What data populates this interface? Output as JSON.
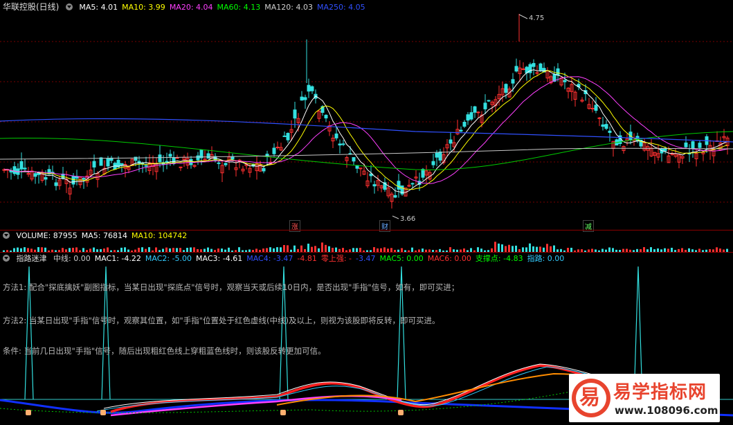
{
  "kline": {
    "title": "华联控股(日线)",
    "ma": [
      {
        "label": "MA5: 4.01",
        "color": "#ffffff"
      },
      {
        "label": "MA10: 3.99",
        "color": "#ffff00"
      },
      {
        "label": "MA20: 4.04",
        "color": "#ff40ff"
      },
      {
        "label": "MA60: 4.13",
        "color": "#00ff00"
      },
      {
        "label": "MA120: 4.03",
        "color": "#d0d0d0"
      },
      {
        "label": "MA250: 4.05",
        "color": "#3050ff"
      }
    ],
    "high_label": "4.75",
    "low_label": "3.66",
    "markers": [
      "涨",
      "财",
      "减"
    ]
  },
  "volume": {
    "items": [
      {
        "label": "VOLUME: 87955",
        "color": "#ffffff"
      },
      {
        "label": "MA5: 76814",
        "color": "#ffffff"
      },
      {
        "label": "MA10: 104742",
        "color": "#ffff00"
      }
    ]
  },
  "indicator": {
    "title": "指路迷津",
    "items": [
      {
        "label": "中线: 0.00",
        "color": "#cccccc"
      },
      {
        "label": "MAC1: -4.22",
        "color": "#ffffff"
      },
      {
        "label": "MAC2: -5.00",
        "color": "#33ccff"
      },
      {
        "label": "MAC3: -4.61",
        "color": "#ffffff"
      },
      {
        "label": "MAC4: -3.47",
        "color": "#3050ff"
      },
      {
        "label": "-4.81",
        "color": "#ff3030"
      },
      {
        "label": "零上强: -",
        "color": "#ff3030"
      },
      {
        "label": "-3.47",
        "color": "#3050ff"
      },
      {
        "label": "MAC5: 0.00",
        "color": "#00ff00"
      },
      {
        "label": "MAC6: 0.00",
        "color": "#ff3030"
      },
      {
        "label": "支撑点: -4.83",
        "color": "#00ff00"
      },
      {
        "label": "指路: 0.00",
        "color": "#33ccff"
      }
    ],
    "notes": [
      "方法1: 配合\"探底擒妖\"副图指标，当某日出现\"探底点\"信号时，观察当天或后续10日内，是否出现\"手指\"信号，如有，即可买进；",
      "方法2: 当某日出现\"手指\"信号时，观察其位置，如\"手指\"位置处于红色虚线(中线)及以上，则视为该股即将反转，即可买进。",
      "条件: 当前几日出现\"手指\"信号，随后出现粗红色线上穿粗蓝色线时，则该股反转更加可信。"
    ]
  },
  "watermark": {
    "brand": "易学指标网",
    "url": "www.108096.com",
    "glyph": "易"
  }
}
